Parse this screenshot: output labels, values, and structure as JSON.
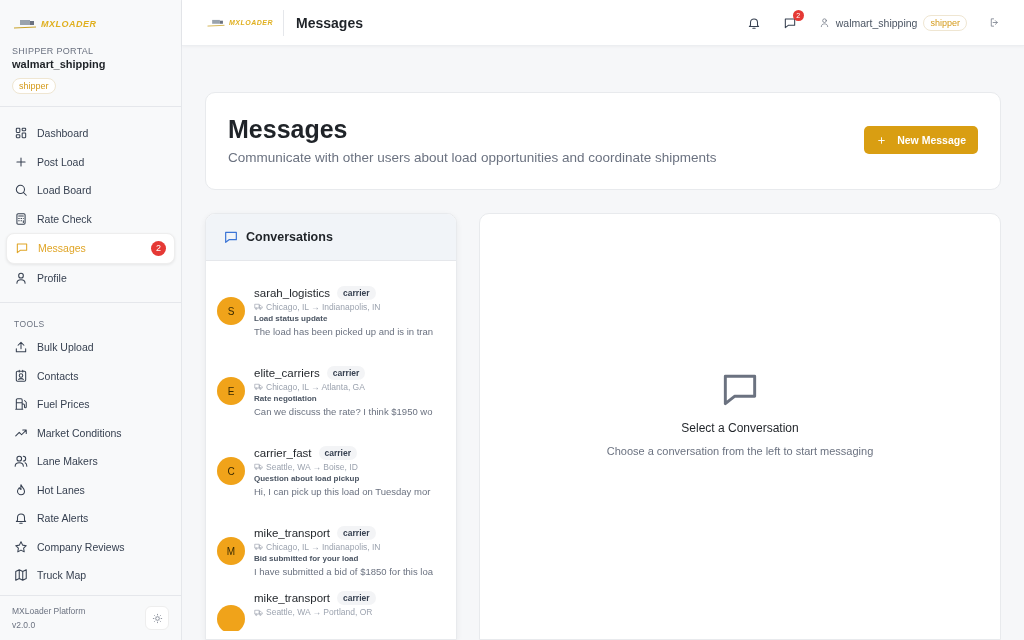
{
  "sidebar": {
    "logo": "MXLOADER",
    "portal_label": "SHIPPER PORTAL",
    "username": "walmart_shipping",
    "role": "shipper",
    "main_items": [
      {
        "label": "Dashboard",
        "selected": false
      },
      {
        "label": "Post Load",
        "selected": false
      },
      {
        "label": "Load Board",
        "selected": false
      },
      {
        "label": "Rate Check",
        "selected": false
      },
      {
        "label": "Messages",
        "selected": true,
        "badge": "2"
      },
      {
        "label": "Profile",
        "selected": false
      }
    ],
    "tools_heading": "TOOLS",
    "tool_items": [
      {
        "label": "Bulk Upload",
        "selected": false
      },
      {
        "label": "Contacts",
        "selected": false
      },
      {
        "label": "Fuel Prices",
        "selected": false
      },
      {
        "label": "Market Conditions",
        "selected": false
      },
      {
        "label": "Lane Makers",
        "selected": false
      },
      {
        "label": "Hot Lanes",
        "selected": false
      },
      {
        "label": "Rate Alerts",
        "selected": false
      },
      {
        "label": "Company Reviews",
        "selected": false
      },
      {
        "label": "Truck Map",
        "selected": false
      }
    ],
    "footer": {
      "platform": "MXLoader Platform",
      "version": "v2.0.0"
    }
  },
  "topbar": {
    "logo": "MXLOADER",
    "title": "Messages",
    "message_count": "2",
    "username": "walmart_shipping",
    "role": "shipper"
  },
  "header": {
    "title": "Messages",
    "subtitle": "Communicate with other users about load opportunities and coordinate shipments",
    "new_button": "New Message"
  },
  "conversations": {
    "title": "Conversations",
    "items": [
      {
        "initial": "S",
        "name": "sarah_logistics",
        "role": "carrier",
        "route": "Chicago, IL → Indianapolis, IN",
        "subject": "Load status update",
        "preview": "The load has been picked up and is in tran"
      },
      {
        "initial": "E",
        "name": "elite_carriers",
        "role": "carrier",
        "route": "Chicago, IL → Atlanta, GA",
        "subject": "Rate negotiation",
        "preview": "Can we discuss the rate? I think $1950 wo"
      },
      {
        "initial": "C",
        "name": "carrier_fast",
        "role": "carrier",
        "route": "Seattle, WA → Boise, ID",
        "subject": "Question about load pickup",
        "preview": "Hi, I can pick up this load on Tuesday mor"
      },
      {
        "initial": "M",
        "name": "mike_transport",
        "role": "carrier",
        "route": "Chicago, IL → Indianapolis, IN",
        "subject": "Bid submitted for your load",
        "preview": "I have submitted a bid of $1850 for this loa"
      },
      {
        "name": "mike_transport",
        "role": "carrier",
        "route": "Seattle, WA → Portland, OR"
      }
    ]
  },
  "empty_state": {
    "title": "Select a Conversation",
    "text": "Choose a conversation from the left to start messaging"
  }
}
